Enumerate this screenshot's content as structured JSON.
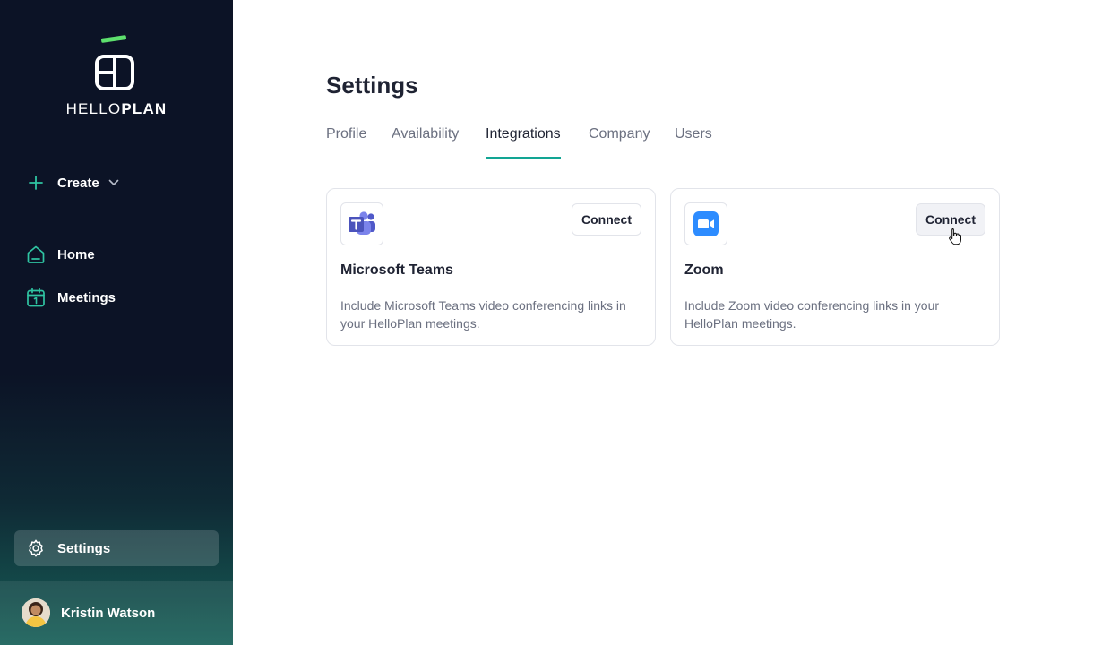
{
  "brand": {
    "logo_text_light": "HELLO",
    "logo_text_bold": "PLAN",
    "accent_green": "#5ee06d",
    "accent_teal": "#12a594"
  },
  "sidebar": {
    "create_label": "Create",
    "items": [
      {
        "label": "Home",
        "icon": "home-icon"
      },
      {
        "label": "Meetings",
        "icon": "calendar-icon"
      }
    ],
    "settings_label": "Settings",
    "user_name": "Kristin Watson"
  },
  "page": {
    "title": "Settings",
    "tabs": [
      {
        "label": "Profile",
        "active": false
      },
      {
        "label": "Availability",
        "active": false
      },
      {
        "label": "Integrations",
        "active": true
      },
      {
        "label": "Company",
        "active": false
      },
      {
        "label": "Users",
        "active": false
      }
    ]
  },
  "integrations": [
    {
      "name": "Microsoft Teams",
      "description": "Include Microsoft Teams video conferencing links in your HelloPlan meetings.",
      "button": "Connect",
      "icon": "microsoft-teams-icon"
    },
    {
      "name": "Zoom",
      "description": "Include Zoom video conferencing links in your HelloPlan meetings.",
      "button": "Connect",
      "icon": "zoom-icon"
    }
  ]
}
